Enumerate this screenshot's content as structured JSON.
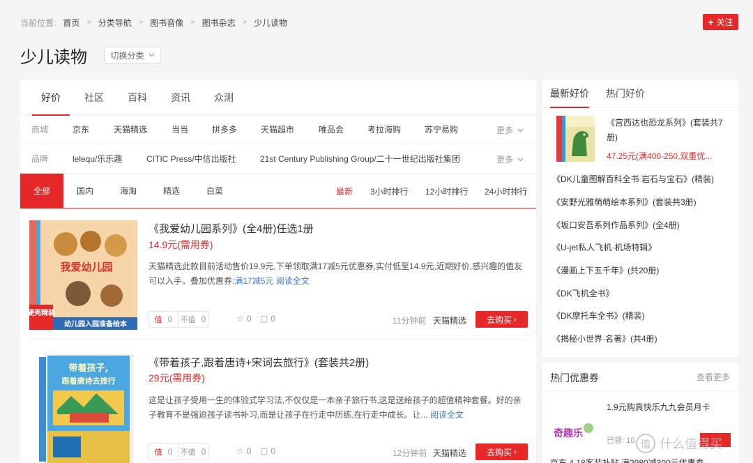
{
  "breadcrumb": {
    "lead": "当前位置:",
    "items": [
      "首页",
      "分类导航",
      "图书音像",
      "图书杂志",
      "少儿读物"
    ]
  },
  "follow_label": "关注",
  "page_title": "少儿读物",
  "switch_label": "切换分类",
  "tabs": [
    "好价",
    "社区",
    "百科",
    "资讯",
    "众测"
  ],
  "mall_filter": {
    "label": "商城",
    "options": [
      "京东",
      "天猫精选",
      "当当",
      "拼多多",
      "天猫超市",
      "唯品会",
      "考拉海购",
      "苏宁易购"
    ],
    "more": "更多"
  },
  "brand_filter": {
    "label": "品牌",
    "options": [
      "lelequ/乐乐趣",
      "CITIC Press/中信出版社",
      "21st Century Publishing Group/二十一世纪出版社集团"
    ],
    "more": "更多"
  },
  "scope_tabs": [
    "全部",
    "国内",
    "海淘",
    "精选",
    "白菜"
  ],
  "sort_tabs": [
    "最新",
    "3小时排行",
    "12小时排行",
    "24小时排行"
  ],
  "articles": [
    {
      "title": "《我爱幼儿园系列》(全4册)任选1册",
      "price": "14.9元(需用券)",
      "desc": "天猫精选此款目前活动售价19.9元,下单领取满17减5元优惠券,实付低至14.9元,近期好价,感兴趣的值友可以入手。叠加优惠券:",
      "coupon_link": "满17减5元",
      "read_more": "阅读全文",
      "worth": "0",
      "unworth": "0",
      "fav": "0",
      "comments": "0",
      "time": "11分钟前",
      "mall": "天猫精选",
      "buy_label": "去购买",
      "cover_text": [
        "我爱幼儿园",
        "硬壳精装",
        "幼儿园入园准备绘本"
      ]
    },
    {
      "title": "《带着孩子,跟着唐诗+宋词去旅行》(套装共2册)",
      "price": "29元(需用券)",
      "desc": "这是让孩子受用一生的体验式学习法,不仅仅是一本亲子旅行书,这是送给孩子的超值精神套餐。好的亲子教育不是强迫孩子读书补习,而是让孩子在行走中历练,在行走中成长。让...",
      "coupon_link": "",
      "read_more": "阅读全文",
      "worth": "0",
      "unworth": "0",
      "fav": "0",
      "comments": "0",
      "time": "12分钟前",
      "mall": "天猫精选",
      "buy_label": "去购买",
      "cover_text": [
        "带着孩子,",
        "跟着唐诗去旅行"
      ]
    }
  ],
  "vote_labels": {
    "worth": "值",
    "unworth": "不值"
  },
  "sidebar": {
    "tabs": [
      "最新好价",
      "热门好价"
    ],
    "featured": {
      "title": "《宫西达也恐龙系列》(套装共7册)",
      "price": "47.25元(满400-250,双重优..."
    },
    "items": [
      "《DK儿童图解百科全书 岩石与宝石》(精装)",
      "《安野光雅萌萌绘本系列》(套装共3册)",
      "《坂口安吾系列作品系列》(全4册)",
      "《U-jet私人飞机·机场特辑》",
      "《漫画上下五千年》(共20册)",
      "《DK飞机全书》",
      "《DK摩托车全书》(精装)",
      "《揭秘小世界·名著》(共4册)"
    ]
  },
  "coupons": {
    "header": "热门优惠券",
    "more": "查看更多",
    "item_title": "1.9元购真快乐九九会员月卡",
    "sold": "已领: 10",
    "next_item": "京东 4.18客装补贴 满2980减300元优惠券"
  },
  "watermark": "什么值得买",
  "colors": {
    "accent": "#e62828",
    "link": "#3a7bc8"
  }
}
